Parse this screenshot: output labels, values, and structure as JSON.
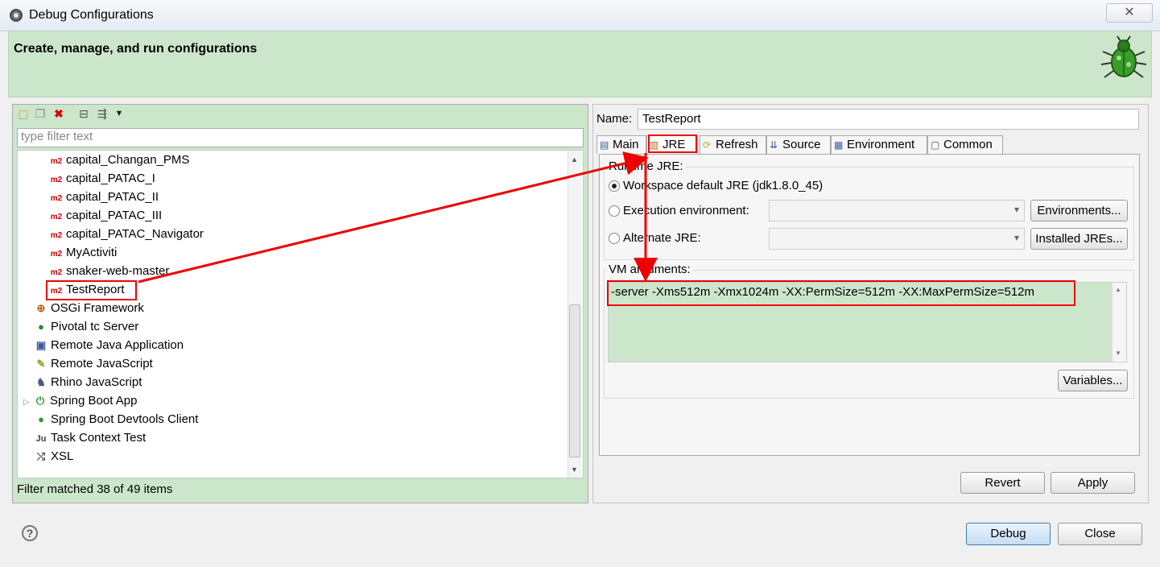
{
  "window": {
    "title": "Debug Configurations",
    "close_label": "✕"
  },
  "header": {
    "text": "Create, manage, and run configurations",
    "icon": "bug-icon"
  },
  "left": {
    "filter_placeholder": "type filter text",
    "items": [
      {
        "label": "capital_Changan_PMS",
        "icon": "m2"
      },
      {
        "label": "capital_PATAC_I",
        "icon": "m2"
      },
      {
        "label": "capital_PATAC_II",
        "icon": "m2"
      },
      {
        "label": "capital_PATAC_III",
        "icon": "m2"
      },
      {
        "label": "capital_PATAC_Navigator",
        "icon": "m2"
      },
      {
        "label": "MyActiviti",
        "icon": "m2"
      },
      {
        "label": "snaker-web-master",
        "icon": "m2"
      },
      {
        "label": "TestReport",
        "icon": "m2"
      },
      {
        "label": "OSGi Framework",
        "icon": "osgi"
      },
      {
        "label": "Pivotal tc Server",
        "icon": "pivotal"
      },
      {
        "label": "Remote Java Application",
        "icon": "remote-java"
      },
      {
        "label": "Remote JavaScript",
        "icon": "remote-js"
      },
      {
        "label": "Rhino JavaScript",
        "icon": "rhino"
      },
      {
        "label": "Spring Boot App",
        "icon": "spring-boot"
      },
      {
        "label": "Spring Boot Devtools Client",
        "icon": "spring-devtools"
      },
      {
        "label": "Task Context Test",
        "icon": "task-context"
      },
      {
        "label": "XSL",
        "icon": "xsl"
      }
    ],
    "status": "Filter matched 38 of 49 items"
  },
  "right": {
    "name_label": "Name:",
    "name_value": "TestReport",
    "tabs": [
      "Main",
      "JRE",
      "Refresh",
      "Source",
      "Environment",
      "Common"
    ],
    "runtime_jre_label": "Runtime JRE:",
    "options": {
      "workspace": "Workspace default JRE (jdk1.8.0_45)",
      "execution": "Execution environment:",
      "alternate": "Alternate JRE:"
    },
    "environments_button": "Environments...",
    "installed_button": "Installed JREs...",
    "vm_label": "VM arguments:",
    "vm_value": "-server -Xms512m -Xmx1024m -XX:PermSize=512m -XX:MaxPermSize=512m",
    "variables_button": "Variables...",
    "revert_button": "Revert",
    "apply_button": "Apply"
  },
  "footer": {
    "help": "?",
    "debug_button": "Debug",
    "close_button": "Close"
  },
  "colors": {
    "green": "#cce6cc",
    "annotation_red": "#e00000"
  }
}
